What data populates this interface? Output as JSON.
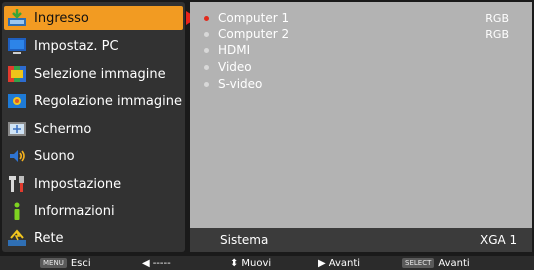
{
  "menu": {
    "items": [
      {
        "label": "Ingresso",
        "icon": "input-icon",
        "active": true
      },
      {
        "label": "Impostaz. PC",
        "icon": "pc-monitor-icon"
      },
      {
        "label": "Selezione immagine",
        "icon": "image-select-icon"
      },
      {
        "label": "Regolazione immagine",
        "icon": "image-adjust-icon"
      },
      {
        "label": "Schermo",
        "icon": "screen-icon"
      },
      {
        "label": "Suono",
        "icon": "sound-icon"
      },
      {
        "label": "Impostazione",
        "icon": "tools-icon"
      },
      {
        "label": "Informazioni",
        "icon": "info-icon"
      },
      {
        "label": "Rete",
        "icon": "network-icon"
      }
    ]
  },
  "inputs": {
    "options": [
      {
        "label": "Computer 1",
        "signal": "RGB",
        "selected": true
      },
      {
        "label": "Computer 2",
        "signal": "RGB"
      },
      {
        "label": "HDMI",
        "signal": ""
      },
      {
        "label": "Video",
        "signal": ""
      },
      {
        "label": "S-video",
        "signal": ""
      }
    ]
  },
  "system": {
    "label": "Sistema",
    "value": "XGA 1"
  },
  "footer": {
    "exit_key": "MENU",
    "exit_label": "Esci",
    "back_label": "-----",
    "move_label": "Muovi",
    "next_label": "Avanti",
    "select_key": "SELECT",
    "select_label": "Avanti"
  },
  "colors": {
    "active": "#f29b22",
    "selected_dot": "#e22a1c",
    "panel": "#b3b3b3"
  }
}
